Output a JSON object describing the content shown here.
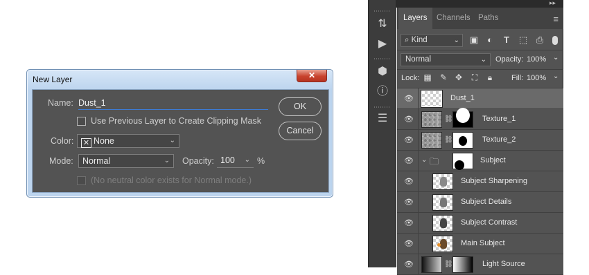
{
  "dialog": {
    "title": "New Layer",
    "close_label": "✕",
    "name_label": "Name:",
    "name_value": "Dust_1",
    "clip_label": "Use Previous Layer to Create Clipping Mask",
    "color_label": "Color:",
    "color_value": "None",
    "mode_label": "Mode:",
    "mode_value": "Normal",
    "opacity_label": "Opacity:",
    "opacity_value": "100",
    "opacity_unit": "%",
    "neutral_label": "(No neutral color exists for Normal mode.)",
    "ok_label": "OK",
    "cancel_label": "Cancel"
  },
  "toolstrip": {
    "collapse_left": "◂◂",
    "collapse_right": "▸▸",
    "tools": [
      "history-icon",
      "play-icon",
      "3d-cube-icon",
      "info-icon",
      "properties-icon"
    ]
  },
  "panel": {
    "tabs": [
      "Layers",
      "Channels",
      "Paths"
    ],
    "active_tab": "Layers",
    "filter_kind": "Kind",
    "blend_mode": "Normal",
    "opacity_label": "Opacity:",
    "opacity_value": "100%",
    "lock_label": "Lock:",
    "fill_label": "Fill:",
    "fill_value": "100%",
    "layers": [
      {
        "name": "Dust_1",
        "selected": true
      },
      {
        "name": "Texture_1"
      },
      {
        "name": "Texture_2"
      },
      {
        "name": "Subject"
      },
      {
        "name": "Subject Sharpening"
      },
      {
        "name": "Subject Details"
      },
      {
        "name": "Subject Contrast"
      },
      {
        "name": "Main Subject"
      },
      {
        "name": "Light Source"
      }
    ]
  },
  "colors": {
    "dialog_bg": "#535353",
    "panel_bg": "#535353",
    "selected_row": "#6a6a6a",
    "focus_underline": "#3d7bd4"
  }
}
